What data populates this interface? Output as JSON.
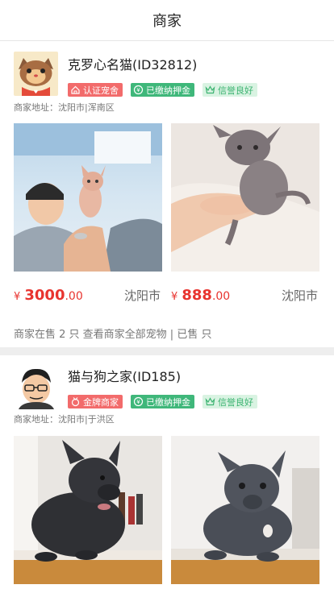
{
  "header": {
    "title": "商家"
  },
  "merchants": [
    {
      "name": "克罗心名猫(ID32812)",
      "badges": [
        "认证宠舍",
        "已缴纳押金",
        "信誉良好"
      ],
      "address": "商家地址：沈阳市|浑南区",
      "pets": [
        {
          "currency": "¥",
          "price_int": "3000",
          "price_dec": ".00",
          "city": "沈阳市"
        },
        {
          "currency": "¥",
          "price_int": "888",
          "price_dec": ".00",
          "city": "沈阳市"
        }
      ],
      "summary": "商家在售 2 只 查看商家全部宠物 | 已售 只"
    },
    {
      "name": "猫与狗之家(ID185)",
      "badges": [
        "金牌商家",
        "已缴纳押金",
        "信誉良好"
      ],
      "address": "商家地址：沈阳市|于洪区"
    }
  ],
  "colors": {
    "price": "#e8342f",
    "badge_red": "#f26b6b",
    "badge_green": "#3fb77a",
    "badge_light": "#d9f3e2"
  }
}
